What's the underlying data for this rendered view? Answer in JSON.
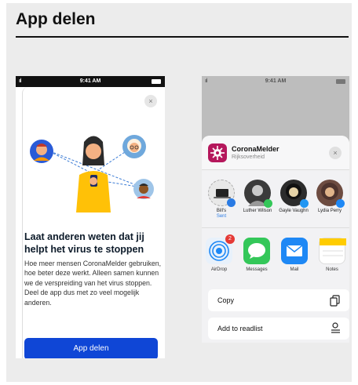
{
  "page": {
    "title": "App delen"
  },
  "left_phone": {
    "status": {
      "signal": "ııl",
      "time": "9:41 AM"
    },
    "close_glyph": "×",
    "headline": "Laat anderen weten dat jij helpt het virus te stoppen",
    "body": "Hoe meer mensen CoronaMelder gebruiken, hoe beter deze werkt. Alleen samen kunnen we de verspreiding van het virus stoppen. Deel de app dus met zo veel mogelijk anderen.",
    "button_label": "App delen",
    "accent_color": "#0f46d6"
  },
  "right_phone": {
    "status": {
      "signal": "ııl",
      "time": "9:41 AM"
    },
    "app": {
      "name": "CoronaMelder",
      "publisher": "Rijksoverheid",
      "icon_color": "#b5175c"
    },
    "close_glyph": "×",
    "people": [
      {
        "name": "Bill's",
        "sub": "Sent",
        "icon": "laptop-avatar"
      },
      {
        "name": "Luther Wilson",
        "sub": "",
        "icon": "person-avatar"
      },
      {
        "name": "Gayle Vaughn",
        "sub": "",
        "icon": "person-avatar"
      },
      {
        "name": "Lydia Perry",
        "sub": "",
        "icon": "person-avatar"
      }
    ],
    "share_apps": [
      {
        "label": "AirDrop",
        "icon": "airdrop-icon",
        "badge": "2",
        "color": "#e8f1fb"
      },
      {
        "label": "Messages",
        "icon": "messages-icon",
        "badge": "",
        "color": "#34c759"
      },
      {
        "label": "Mail",
        "icon": "mail-icon",
        "badge": "",
        "color": "#1e88f5"
      },
      {
        "label": "Notes",
        "icon": "notes-icon",
        "badge": "",
        "color": "#ffffff"
      }
    ],
    "actions": [
      {
        "label": "Copy",
        "icon": "copy-icon"
      },
      {
        "label": "Add to readlist",
        "icon": "readlist-icon"
      }
    ]
  }
}
